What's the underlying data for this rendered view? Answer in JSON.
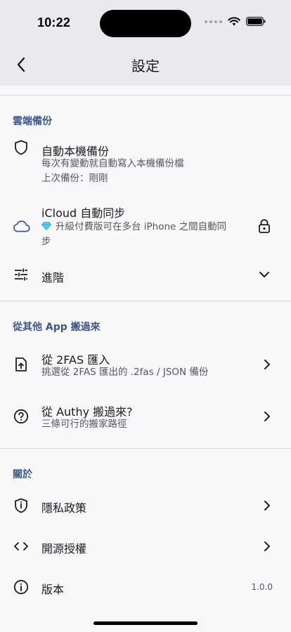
{
  "status": {
    "time": "10:22"
  },
  "nav": {
    "title": "設定"
  },
  "sections": {
    "cloud": {
      "header": "雲端備份",
      "auto_local": {
        "title": "自動本機備份",
        "sub1": "每次有變動就自動寫入本機備份檔",
        "sub2": "上次備份：剛剛"
      },
      "icloud": {
        "title": "iCloud 自動同步",
        "sub_line1": "升級付費版可在多台 iPhone 之間自動同",
        "sub_line2": "步"
      },
      "advanced": {
        "title": "進階"
      }
    },
    "migrate": {
      "header": "從其他 App 搬過來",
      "twofas": {
        "title": "從 2FAS 匯入",
        "sub": "挑選從 2FAS 匯出的 .2fas / JSON 備份"
      },
      "authy": {
        "title": "從 Authy 搬過來?",
        "sub": "三條可行的搬家路徑"
      }
    },
    "about": {
      "header": "關於",
      "privacy": {
        "title": "隱私政策"
      },
      "license": {
        "title": "開源授權"
      },
      "version": {
        "title": "版本",
        "value": "1.0.0"
      }
    }
  },
  "colors": {
    "section_header": "#3f5586",
    "background": "#f8f8fb",
    "navbar": "#e9e9ee"
  },
  "icons": [
    "back-chevron-icon",
    "wifi-icon",
    "battery-icon",
    "shield-icon",
    "cloud-icon",
    "diamond-icon",
    "lock-icon",
    "tune-icon",
    "chevron-down-icon",
    "file-upload-icon",
    "help-circle-icon",
    "privacy-shield-icon",
    "code-icon",
    "info-icon",
    "chevron-right-icon"
  ]
}
